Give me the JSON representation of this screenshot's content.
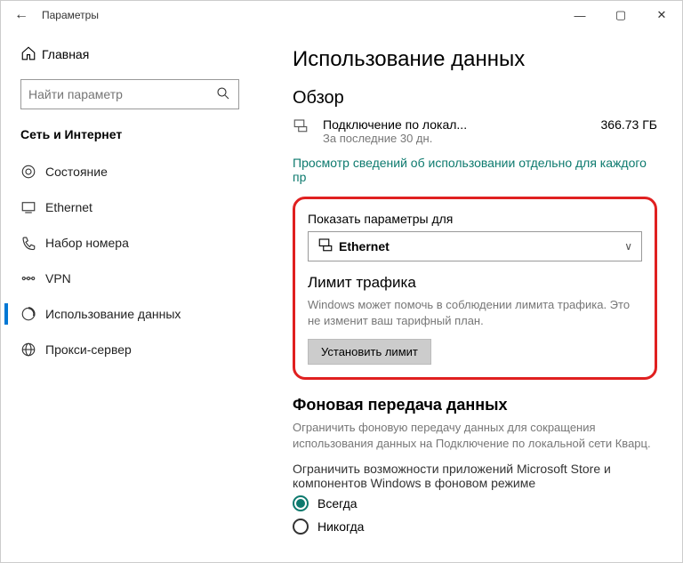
{
  "window": {
    "title": "Параметры"
  },
  "sidebar": {
    "home": "Главная",
    "search_placeholder": "Найти параметр",
    "category": "Сеть и Интернет",
    "items": [
      {
        "label": "Состояние"
      },
      {
        "label": "Ethernet"
      },
      {
        "label": "Набор номера"
      },
      {
        "label": "VPN"
      },
      {
        "label": "Использование данных"
      },
      {
        "label": "Прокси-сервер"
      }
    ]
  },
  "page": {
    "title": "Использование данных",
    "overview": {
      "heading": "Обзор",
      "connection": "Подключение по локал...",
      "period": "За последние 30 дн.",
      "amount": "366.73 ГБ",
      "link": "Просмотр сведений об использовании отдельно для каждого пр"
    },
    "show_for": {
      "label": "Показать параметры для",
      "value": "Ethernet"
    },
    "limit": {
      "heading": "Лимит трафика",
      "desc": "Windows может помочь в соблюдении лимита трафика. Это не изменит ваш тарифный план.",
      "button": "Установить лимит"
    },
    "background": {
      "heading": "Фоновая передача данных",
      "desc": "Ограничить фоновую передачу данных для сокращения использования данных на Подключение по локальной сети Кварц.",
      "option_label": "Ограничить возможности приложений Microsoft Store и компонентов Windows в фоновом режиме",
      "options": {
        "always": "Всегда",
        "never": "Никогда"
      }
    }
  }
}
